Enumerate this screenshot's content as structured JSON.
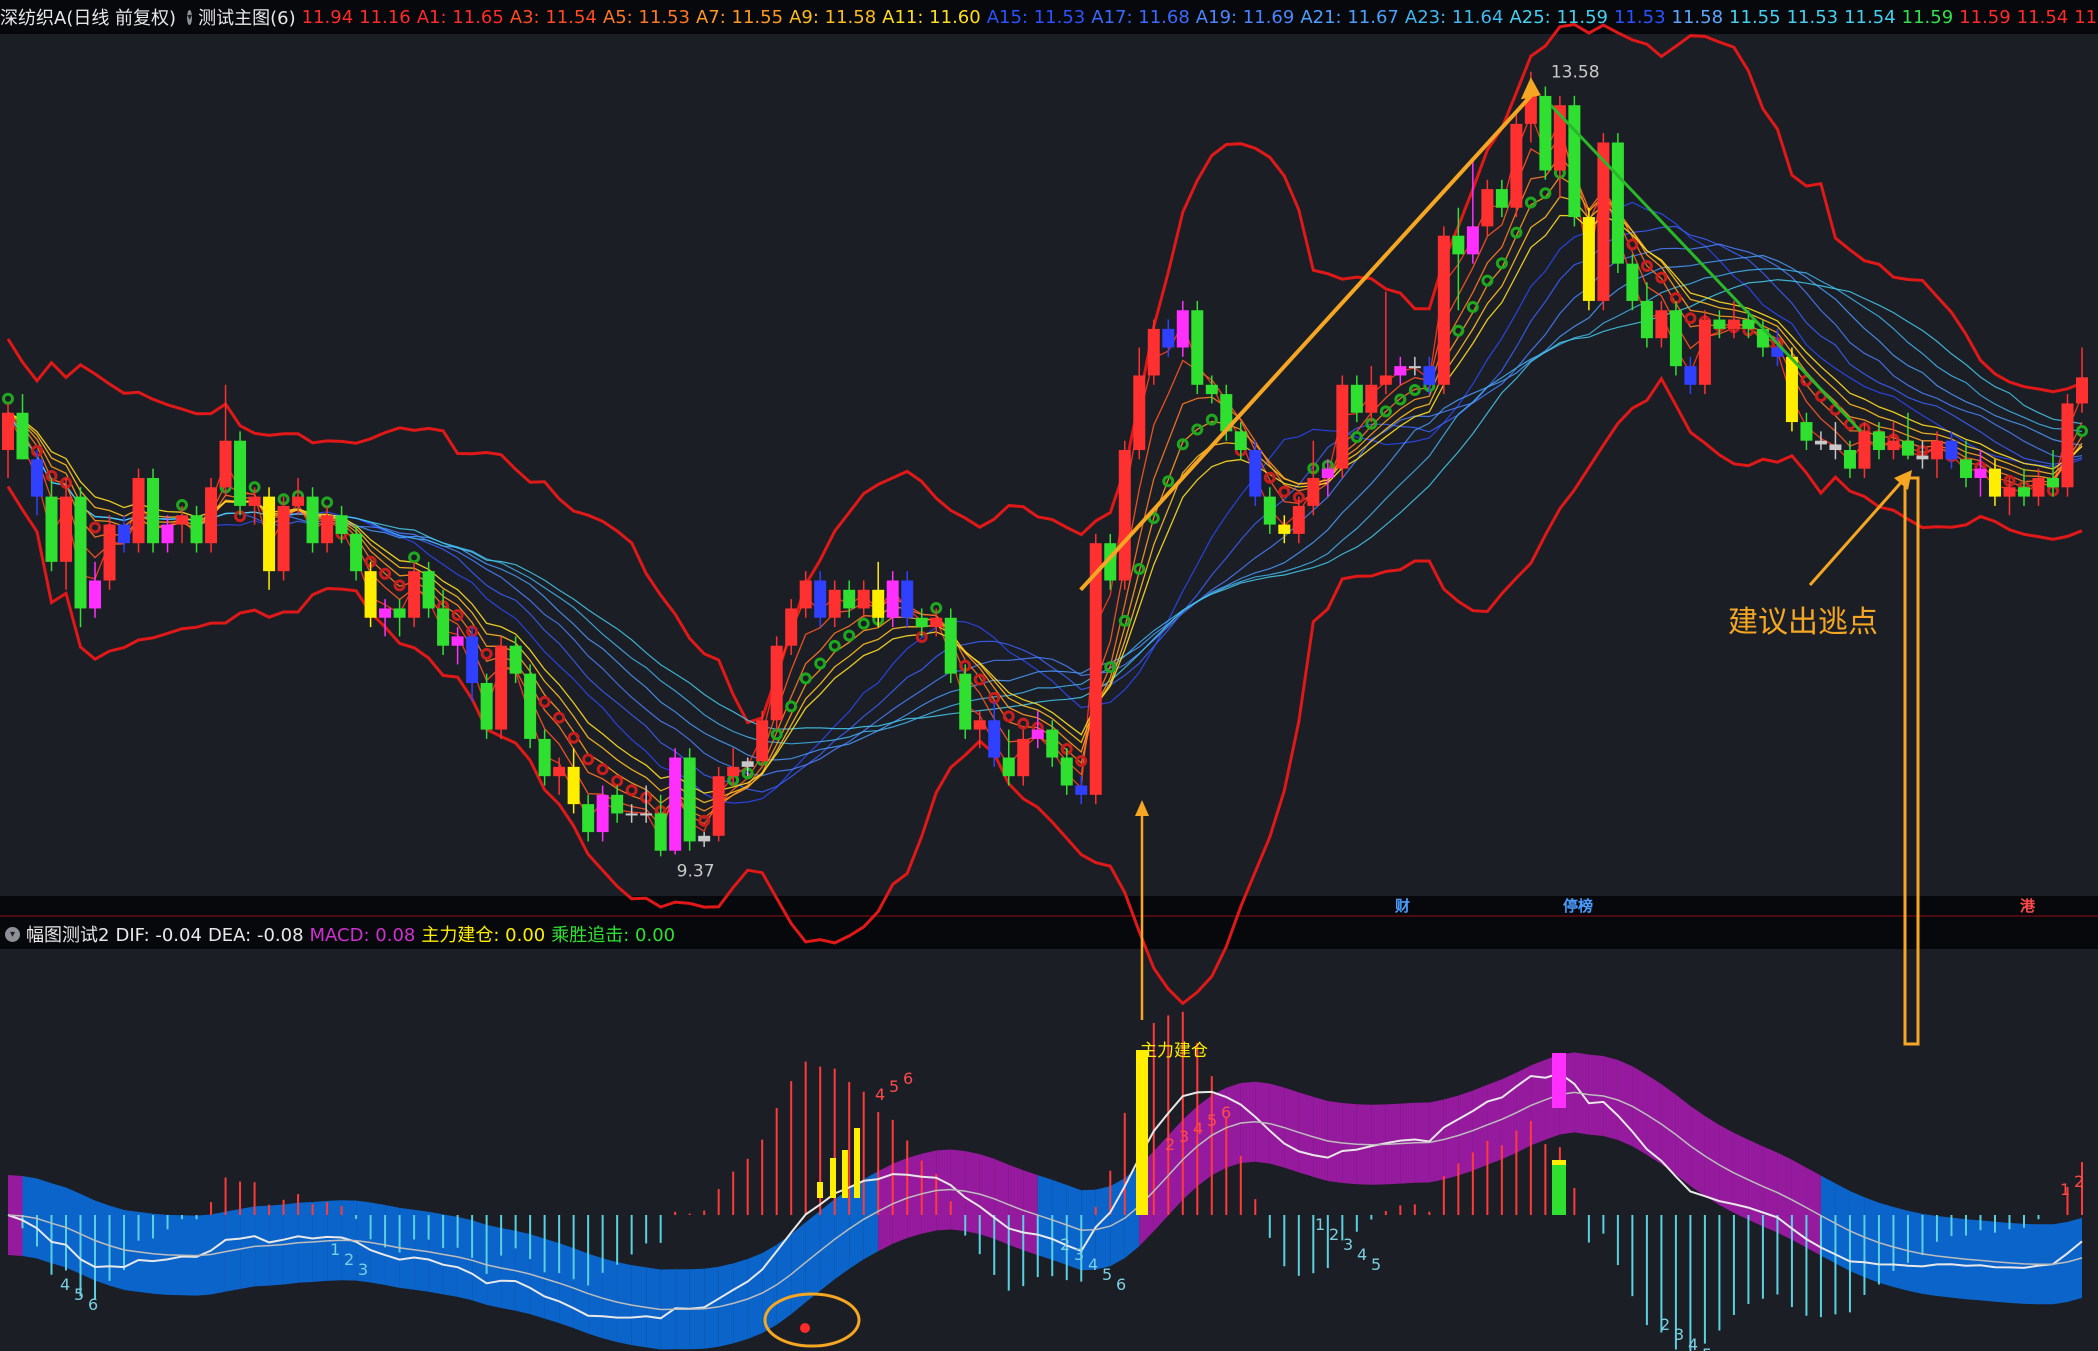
{
  "header": {
    "title": "深纺织A(日线 前复权)",
    "indicator_name": "测试主图(6)",
    "values": [
      {
        "text": "11.94",
        "color": "#ff2a2a"
      },
      {
        "text": "11.16",
        "color": "#ff2a2a"
      },
      {
        "text": "A1: 11.65",
        "color": "#ff2a2a"
      },
      {
        "text": "A3: 11.54",
        "color": "#ff4a22"
      },
      {
        "text": "A5: 11.53",
        "color": "#ff7722"
      },
      {
        "text": "A7: 11.55",
        "color": "#ff9922"
      },
      {
        "text": "A9: 11.58",
        "color": "#ffbb22"
      },
      {
        "text": "A11: 11.60",
        "color": "#ffdd22"
      },
      {
        "text": "A15: 11.53",
        "color": "#2a52ff"
      },
      {
        "text": "A17: 11.68",
        "color": "#3a6aff"
      },
      {
        "text": "A19: 11.69",
        "color": "#4a86ff"
      },
      {
        "text": "A21: 11.67",
        "color": "#4aa0ff"
      },
      {
        "text": "A23: 11.64",
        "color": "#42b8f0"
      },
      {
        "text": "A25: 11.59",
        "color": "#44d0f0"
      },
      {
        "text": "11.53",
        "color": "#2a52ff"
      },
      {
        "text": "11.58",
        "color": "#5aa8ff"
      },
      {
        "text": "11.55",
        "color": "#44d0f0"
      },
      {
        "text": "11.53",
        "color": "#44d0f0"
      },
      {
        "text": "11.54",
        "color": "#44d0f0"
      },
      {
        "text": "11.59",
        "color": "#30e050"
      },
      {
        "text": "11.59",
        "color": "#ff2a2a"
      },
      {
        "text": "11.54",
        "color": "#ff2a2a"
      },
      {
        "text": "11.53",
        "color": "#ff2a2a"
      }
    ]
  },
  "subheader": {
    "indicator_name": "幅图测试2",
    "values": [
      {
        "text": "DIF: -0.04",
        "color": "#e8e8e8"
      },
      {
        "text": "DEA: -0.08",
        "color": "#e8e8e8"
      },
      {
        "text": "MACD: 0.08",
        "color": "#d030d0"
      },
      {
        "text": "主力建仓: 0.00",
        "color": "#ffee00"
      },
      {
        "text": "乘胜追击: 0.00",
        "color": "#30e030"
      }
    ]
  },
  "annotations": {
    "high_price": "13.58",
    "low_price": "9.37",
    "escape_point": "建议出逃点",
    "main_build": "主力建仓",
    "event_tags": [
      {
        "text": "财",
        "color": "#4a9cff"
      },
      {
        "text": "停榜",
        "color": "#4a9cff"
      },
      {
        "text": "港",
        "color": "#ff4a4a"
      }
    ]
  },
  "chart_data": [
    {
      "type": "candlestick",
      "candles": [
        {
          "o": 11.55,
          "h": 11.8,
          "l": 11.4,
          "c": 11.75
        },
        {
          "o": 11.75,
          "h": 11.85,
          "l": 11.5,
          "c": 11.5
        },
        {
          "o": 11.5,
          "h": 11.55,
          "l": 11.2,
          "c": 11.3
        },
        {
          "o": 11.3,
          "h": 11.4,
          "l": 10.9,
          "c": 10.95
        },
        {
          "o": 10.95,
          "h": 11.4,
          "l": 10.8,
          "c": 11.3
        },
        {
          "o": 11.3,
          "h": 11.35,
          "l": 10.6,
          "c": 10.7
        },
        {
          "o": 10.7,
          "h": 10.95,
          "l": 10.65,
          "c": 10.85
        },
        {
          "o": 10.85,
          "h": 11.2,
          "l": 10.8,
          "c": 11.15
        },
        {
          "o": 11.15,
          "h": 11.2,
          "l": 11.0,
          "c": 11.05
        },
        {
          "o": 11.05,
          "h": 11.45,
          "l": 11.0,
          "c": 11.4
        },
        {
          "o": 11.4,
          "h": 11.45,
          "l": 11.0,
          "c": 11.05
        },
        {
          "o": 11.05,
          "h": 11.2,
          "l": 11.0,
          "c": 11.15
        },
        {
          "o": 11.15,
          "h": 11.25,
          "l": 11.05,
          "c": 11.2
        },
        {
          "o": 11.2,
          "h": 11.25,
          "l": 11.0,
          "c": 11.05
        },
        {
          "o": 11.05,
          "h": 11.4,
          "l": 11.0,
          "c": 11.35
        },
        {
          "o": 11.35,
          "h": 11.9,
          "l": 11.3,
          "c": 11.6
        },
        {
          "o": 11.6,
          "h": 11.65,
          "l": 11.2,
          "c": 11.25
        },
        {
          "o": 11.25,
          "h": 11.35,
          "l": 11.15,
          "c": 11.3
        },
        {
          "o": 11.3,
          "h": 11.35,
          "l": 10.8,
          "c": 10.9
        },
        {
          "o": 10.9,
          "h": 11.3,
          "l": 10.85,
          "c": 11.25
        },
        {
          "o": 11.25,
          "h": 11.4,
          "l": 11.2,
          "c": 11.3
        },
        {
          "o": 11.3,
          "h": 11.35,
          "l": 11.0,
          "c": 11.05
        },
        {
          "o": 11.05,
          "h": 11.25,
          "l": 11.0,
          "c": 11.2
        },
        {
          "o": 11.2,
          "h": 11.25,
          "l": 11.05,
          "c": 11.1
        },
        {
          "o": 11.1,
          "h": 11.15,
          "l": 10.85,
          "c": 10.9
        },
        {
          "o": 10.9,
          "h": 10.95,
          "l": 10.6,
          "c": 10.65
        },
        {
          "o": 10.65,
          "h": 10.75,
          "l": 10.55,
          "c": 10.7
        },
        {
          "o": 10.7,
          "h": 10.75,
          "l": 10.55,
          "c": 10.65
        },
        {
          "o": 10.65,
          "h": 10.95,
          "l": 10.6,
          "c": 10.9
        },
        {
          "o": 10.9,
          "h": 10.95,
          "l": 10.65,
          "c": 10.7
        },
        {
          "o": 10.7,
          "h": 10.8,
          "l": 10.45,
          "c": 10.5
        },
        {
          "o": 10.5,
          "h": 10.6,
          "l": 10.4,
          "c": 10.55
        },
        {
          "o": 10.55,
          "h": 10.6,
          "l": 10.2,
          "c": 10.3
        },
        {
          "o": 10.3,
          "h": 10.35,
          "l": 10.0,
          "c": 10.05
        },
        {
          "o": 10.05,
          "h": 10.55,
          "l": 10.0,
          "c": 10.5
        },
        {
          "o": 10.5,
          "h": 10.55,
          "l": 10.3,
          "c": 10.35
        },
        {
          "o": 10.35,
          "h": 10.4,
          "l": 9.95,
          "c": 10.0
        },
        {
          "o": 10.0,
          "h": 10.05,
          "l": 9.75,
          "c": 9.8
        },
        {
          "o": 9.8,
          "h": 9.9,
          "l": 9.7,
          "c": 9.85
        },
        {
          "o": 9.85,
          "h": 9.95,
          "l": 9.6,
          "c": 9.65
        },
        {
          "o": 9.65,
          "h": 9.7,
          "l": 9.45,
          "c": 9.5
        },
        {
          "o": 9.5,
          "h": 9.75,
          "l": 9.45,
          "c": 9.7
        },
        {
          "o": 9.7,
          "h": 9.75,
          "l": 9.55,
          "c": 9.6
        },
        {
          "o": 9.6,
          "h": 9.65,
          "l": 9.55,
          "c": 9.6
        },
        {
          "o": 9.6,
          "h": 9.75,
          "l": 9.55,
          "c": 9.6
        },
        {
          "o": 9.6,
          "h": 9.7,
          "l": 9.37,
          "c": 9.4
        },
        {
          "o": 9.4,
          "h": 9.95,
          "l": 9.38,
          "c": 9.9
        },
        {
          "o": 9.9,
          "h": 9.95,
          "l": 9.4,
          "c": 9.45
        },
        {
          "o": 9.45,
          "h": 9.5,
          "l": 9.42,
          "c": 9.48
        },
        {
          "o": 9.48,
          "h": 9.85,
          "l": 9.45,
          "c": 9.8
        },
        {
          "o": 9.8,
          "h": 9.95,
          "l": 9.75,
          "c": 9.85
        },
        {
          "o": 9.85,
          "h": 9.9,
          "l": 9.8,
          "c": 9.88
        },
        {
          "o": 9.88,
          "h": 10.15,
          "l": 9.85,
          "c": 10.1
        },
        {
          "o": 10.1,
          "h": 10.55,
          "l": 10.05,
          "c": 10.5
        },
        {
          "o": 10.5,
          "h": 10.75,
          "l": 10.45,
          "c": 10.7
        },
        {
          "o": 10.7,
          "h": 10.9,
          "l": 10.65,
          "c": 10.85
        },
        {
          "o": 10.85,
          "h": 10.9,
          "l": 10.6,
          "c": 10.65
        },
        {
          "o": 10.65,
          "h": 10.85,
          "l": 10.6,
          "c": 10.8
        },
        {
          "o": 10.8,
          "h": 10.85,
          "l": 10.65,
          "c": 10.7
        },
        {
          "o": 10.7,
          "h": 10.85,
          "l": 10.65,
          "c": 10.8
        },
        {
          "o": 10.8,
          "h": 10.95,
          "l": 10.6,
          "c": 10.65
        },
        {
          "o": 10.65,
          "h": 10.9,
          "l": 10.6,
          "c": 10.85
        },
        {
          "o": 10.85,
          "h": 10.9,
          "l": 10.6,
          "c": 10.65
        },
        {
          "o": 10.65,
          "h": 10.7,
          "l": 10.55,
          "c": 10.6
        },
        {
          "o": 10.6,
          "h": 10.7,
          "l": 10.55,
          "c": 10.65
        },
        {
          "o": 10.65,
          "h": 10.7,
          "l": 10.3,
          "c": 10.35
        },
        {
          "o": 10.35,
          "h": 10.4,
          "l": 10.0,
          "c": 10.05
        },
        {
          "o": 10.05,
          "h": 10.15,
          "l": 9.95,
          "c": 10.1
        },
        {
          "o": 10.1,
          "h": 10.2,
          "l": 9.85,
          "c": 9.9
        },
        {
          "o": 9.9,
          "h": 10.05,
          "l": 9.75,
          "c": 9.8
        },
        {
          "o": 9.8,
          "h": 10.05,
          "l": 9.75,
          "c": 10.0
        },
        {
          "o": 10.0,
          "h": 10.15,
          "l": 9.95,
          "c": 10.05
        },
        {
          "o": 10.05,
          "h": 10.1,
          "l": 9.85,
          "c": 9.9
        },
        {
          "o": 9.9,
          "h": 9.95,
          "l": 9.7,
          "c": 9.75
        },
        {
          "o": 9.75,
          "h": 9.8,
          "l": 9.65,
          "c": 9.7
        },
        {
          "o": 9.7,
          "h": 11.1,
          "l": 9.65,
          "c": 11.05
        },
        {
          "o": 11.05,
          "h": 11.1,
          "l": 10.8,
          "c": 10.85
        },
        {
          "o": 10.85,
          "h": 11.6,
          "l": 10.8,
          "c": 11.55
        },
        {
          "o": 11.55,
          "h": 12.1,
          "l": 11.5,
          "c": 11.95
        },
        {
          "o": 11.95,
          "h": 12.25,
          "l": 11.9,
          "c": 12.2
        },
        {
          "o": 12.2,
          "h": 12.25,
          "l": 12.05,
          "c": 12.1
        },
        {
          "o": 12.1,
          "h": 12.35,
          "l": 12.05,
          "c": 12.3
        },
        {
          "o": 12.3,
          "h": 12.35,
          "l": 11.85,
          "c": 11.9
        },
        {
          "o": 11.9,
          "h": 11.95,
          "l": 11.8,
          "c": 11.85
        },
        {
          "o": 11.85,
          "h": 11.9,
          "l": 11.6,
          "c": 11.65
        },
        {
          "o": 11.65,
          "h": 11.7,
          "l": 11.5,
          "c": 11.55
        },
        {
          "o": 11.55,
          "h": 11.6,
          "l": 11.25,
          "c": 11.3
        },
        {
          "o": 11.3,
          "h": 11.35,
          "l": 11.1,
          "c": 11.15
        },
        {
          "o": 11.15,
          "h": 11.2,
          "l": 11.05,
          "c": 11.1
        },
        {
          "o": 11.1,
          "h": 11.3,
          "l": 11.05,
          "c": 11.25
        },
        {
          "o": 11.25,
          "h": 11.6,
          "l": 11.2,
          "c": 11.4
        },
        {
          "o": 11.4,
          "h": 11.5,
          "l": 11.3,
          "c": 11.45
        },
        {
          "o": 11.45,
          "h": 11.95,
          "l": 11.4,
          "c": 11.9
        },
        {
          "o": 11.9,
          "h": 11.95,
          "l": 11.7,
          "c": 11.75
        },
        {
          "o": 11.75,
          "h": 12.0,
          "l": 11.7,
          "c": 11.9
        },
        {
          "o": 11.9,
          "h": 12.4,
          "l": 11.85,
          "c": 11.95
        },
        {
          "o": 11.95,
          "h": 12.05,
          "l": 11.9,
          "c": 12.0
        },
        {
          "o": 12.0,
          "h": 12.05,
          "l": 11.95,
          "c": 12.0
        },
        {
          "o": 12.0,
          "h": 12.05,
          "l": 11.85,
          "c": 11.9
        },
        {
          "o": 11.9,
          "h": 12.75,
          "l": 11.85,
          "c": 12.7
        },
        {
          "o": 12.7,
          "h": 12.85,
          "l": 12.3,
          "c": 12.6
        },
        {
          "o": 12.6,
          "h": 13.1,
          "l": 12.55,
          "c": 12.75
        },
        {
          "o": 12.75,
          "h": 13.0,
          "l": 12.7,
          "c": 12.95
        },
        {
          "o": 12.95,
          "h": 13.0,
          "l": 12.8,
          "c": 12.85
        },
        {
          "o": 12.85,
          "h": 13.35,
          "l": 12.8,
          "c": 13.3
        },
        {
          "o": 13.3,
          "h": 13.58,
          "l": 13.2,
          "c": 13.45
        },
        {
          "o": 13.45,
          "h": 13.5,
          "l": 13.0,
          "c": 13.05
        },
        {
          "o": 13.05,
          "h": 13.45,
          "l": 12.9,
          "c": 13.4
        },
        {
          "o": 13.4,
          "h": 13.45,
          "l": 12.75,
          "c": 12.8
        },
        {
          "o": 12.8,
          "h": 12.85,
          "l": 12.3,
          "c": 12.35
        },
        {
          "o": 12.35,
          "h": 13.25,
          "l": 12.3,
          "c": 13.2
        },
        {
          "o": 13.2,
          "h": 13.25,
          "l": 12.5,
          "c": 12.55
        },
        {
          "o": 12.55,
          "h": 12.6,
          "l": 12.3,
          "c": 12.35
        },
        {
          "o": 12.35,
          "h": 12.45,
          "l": 12.1,
          "c": 12.15
        },
        {
          "o": 12.15,
          "h": 12.35,
          "l": 12.1,
          "c": 12.3
        },
        {
          "o": 12.3,
          "h": 12.35,
          "l": 11.95,
          "c": 12.0
        },
        {
          "o": 12.0,
          "h": 12.05,
          "l": 11.85,
          "c": 11.9
        },
        {
          "o": 11.9,
          "h": 12.3,
          "l": 11.85,
          "c": 12.25
        },
        {
          "o": 12.25,
          "h": 12.3,
          "l": 12.15,
          "c": 12.2
        },
        {
          "o": 12.2,
          "h": 12.35,
          "l": 12.15,
          "c": 12.25
        },
        {
          "o": 12.25,
          "h": 12.3,
          "l": 12.15,
          "c": 12.2
        },
        {
          "o": 12.2,
          "h": 12.25,
          "l": 12.05,
          "c": 12.1
        },
        {
          "o": 12.1,
          "h": 12.2,
          "l": 12.0,
          "c": 12.05
        },
        {
          "o": 12.05,
          "h": 12.1,
          "l": 11.65,
          "c": 11.7
        },
        {
          "o": 11.7,
          "h": 11.75,
          "l": 11.55,
          "c": 11.6
        },
        {
          "o": 11.6,
          "h": 11.65,
          "l": 11.55,
          "c": 11.58
        },
        {
          "o": 11.58,
          "h": 11.7,
          "l": 11.5,
          "c": 11.55
        },
        {
          "o": 11.55,
          "h": 11.6,
          "l": 11.4,
          "c": 11.45
        },
        {
          "o": 11.45,
          "h": 11.7,
          "l": 11.4,
          "c": 11.65
        },
        {
          "o": 11.65,
          "h": 11.7,
          "l": 11.5,
          "c": 11.55
        },
        {
          "o": 11.55,
          "h": 11.7,
          "l": 11.5,
          "c": 11.6
        },
        {
          "o": 11.6,
          "h": 11.75,
          "l": 11.5,
          "c": 11.52
        },
        {
          "o": 11.52,
          "h": 11.6,
          "l": 11.45,
          "c": 11.5
        },
        {
          "o": 11.5,
          "h": 11.65,
          "l": 11.4,
          "c": 11.6
        },
        {
          "o": 11.6,
          "h": 11.65,
          "l": 11.45,
          "c": 11.5
        },
        {
          "o": 11.5,
          "h": 11.6,
          "l": 11.35,
          "c": 11.4
        },
        {
          "o": 11.4,
          "h": 11.55,
          "l": 11.3,
          "c": 11.45
        },
        {
          "o": 11.45,
          "h": 11.5,
          "l": 11.25,
          "c": 11.3
        },
        {
          "o": 11.3,
          "h": 11.4,
          "l": 11.2,
          "c": 11.35
        },
        {
          "o": 11.35,
          "h": 11.45,
          "l": 11.25,
          "c": 11.3
        },
        {
          "o": 11.3,
          "h": 11.45,
          "l": 11.25,
          "c": 11.4
        },
        {
          "o": 11.4,
          "h": 11.55,
          "l": 11.3,
          "c": 11.35
        },
        {
          "o": 11.35,
          "h": 11.85,
          "l": 11.3,
          "c": 11.8
        },
        {
          "o": 11.8,
          "h": 12.1,
          "l": 11.75,
          "c": 11.94
        }
      ]
    },
    {
      "type": "bar",
      "macd_label_groups": [
        {
          "digits": [
            "4",
            "5",
            "6"
          ],
          "side": "down"
        },
        {
          "digits": [
            "1",
            "2",
            "3"
          ],
          "side": "down"
        },
        {
          "digits": [
            "4",
            "5",
            "6"
          ],
          "side": "up"
        },
        {
          "digits": [
            "2",
            "3",
            "4",
            "5",
            "6"
          ],
          "side": "down"
        },
        {
          "digits": [
            "2",
            "3",
            "4",
            "5",
            "6"
          ],
          "side": "up"
        },
        {
          "digits": [
            "1",
            "2",
            "3",
            "4",
            "5"
          ],
          "side": "down"
        },
        {
          "digits": [
            "2",
            "3",
            "4",
            "5",
            "6"
          ],
          "side": "down"
        },
        {
          "digits": [
            "1",
            "2"
          ],
          "side": "up"
        }
      ]
    }
  ]
}
